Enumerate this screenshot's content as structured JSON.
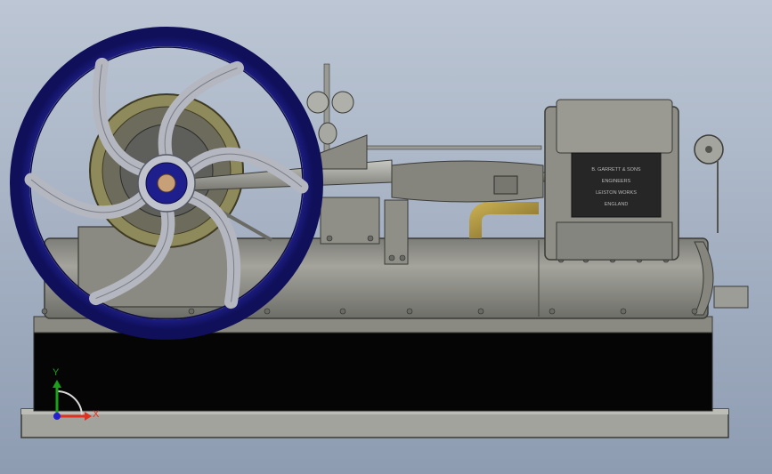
{
  "viewport": {
    "background_top": "#bcc6d4",
    "background_bottom": "#8e9cb2"
  },
  "colors": {
    "flywheel_rim": "#1e1e8c",
    "flywheel_spokes": "#b4b7c0",
    "bed_steel": "#8d8d86",
    "plinth": "#050505",
    "base_plate": "#a3a39d",
    "brass": "#a08a3a",
    "bronze_ring": "#8f8a5c",
    "valve_plate": "#262626"
  },
  "nameplate": {
    "lines": [
      "B. GARRETT & SONS",
      "ENGINEERS",
      "LEISTON WORKS",
      "ENGLAND"
    ]
  },
  "triad": {
    "x_label": "X",
    "y_label": "Y",
    "x_color": "#e03020",
    "y_color": "#1aa01a",
    "z_color": "#2020d0"
  }
}
